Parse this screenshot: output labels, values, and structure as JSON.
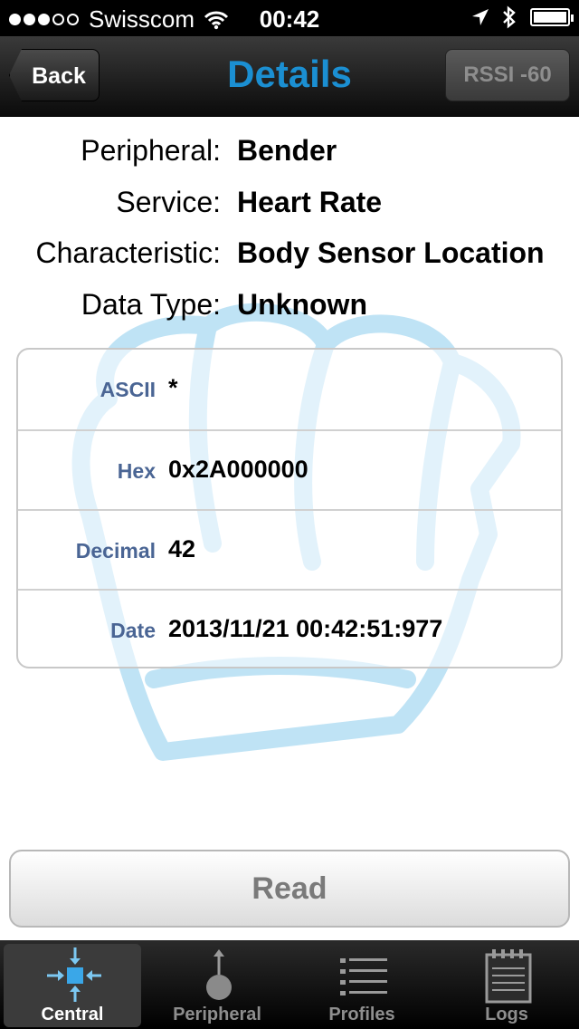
{
  "status_bar": {
    "carrier": "Swisscom",
    "time": "00:42"
  },
  "nav": {
    "back_label": "Back",
    "title": "Details",
    "rssi_label": "RSSI -60"
  },
  "info": {
    "peripheral_label": "Peripheral:",
    "peripheral_value": "Bender",
    "service_label": "Service:",
    "service_value": "Heart Rate",
    "characteristic_label": "Characteristic:",
    "characteristic_value": "Body Sensor Location",
    "data_type_label": "Data Type:",
    "data_type_value": "Unknown"
  },
  "values": [
    {
      "label": "ASCII",
      "value": "*"
    },
    {
      "label": "Hex",
      "value": "0x2A000000"
    },
    {
      "label": "Decimal",
      "value": "42"
    },
    {
      "label": "Date",
      "value": "2013/11/21 00:42:51:977"
    }
  ],
  "read_button": "Read",
  "tabs": [
    {
      "label": "Central",
      "icon": "central-icon"
    },
    {
      "label": "Peripheral",
      "icon": "peripheral-icon"
    },
    {
      "label": "Profiles",
      "icon": "profiles-icon"
    },
    {
      "label": "Logs",
      "icon": "logs-icon"
    }
  ],
  "colors": {
    "title_blue": "#1b8fd2",
    "label_blue": "#4a6594",
    "watermark": "#bfe3f5"
  }
}
